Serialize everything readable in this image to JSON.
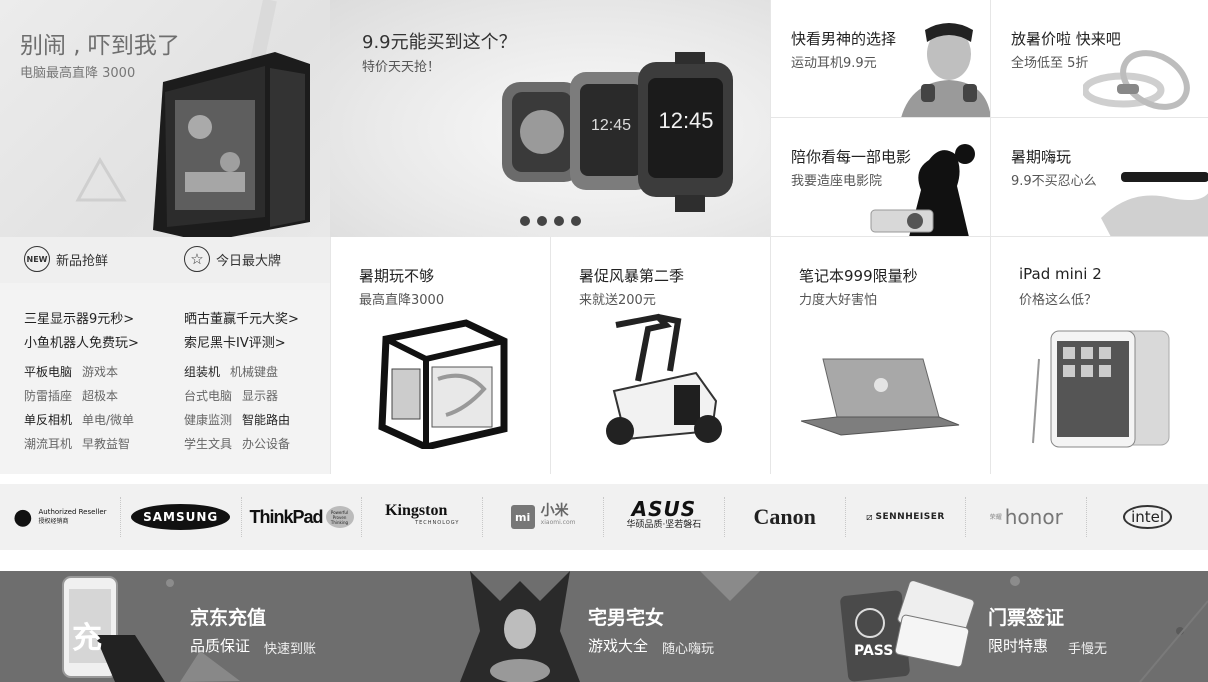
{
  "hero_left": {
    "title": "别闹 , 吓到我了",
    "subtitle": "电脑最高直降 3000"
  },
  "hero_center": {
    "title": "9.9元能买到这个？",
    "subtitle": "特价天天抢！",
    "carousel_dots": 4
  },
  "small_cards": [
    {
      "title": "快看男神的选择",
      "subtitle": "运动耳机9.9元"
    },
    {
      "title": "放暑价啦 快来吧",
      "subtitle": "全场低至 5折"
    },
    {
      "title": "陪你看每一部电影",
      "subtitle": "我要造座电影院"
    },
    {
      "title": "暑期嗨玩",
      "subtitle": "9.9不买忍心么"
    }
  ],
  "left_tabs": [
    {
      "badge": "NEW",
      "label": "新品抢鲜"
    },
    {
      "badge": "☆",
      "label": "今日最大牌"
    }
  ],
  "promo_links": [
    "三星显示器9元秒>",
    "晒古董赢千元大奖>",
    "小鱼机器人免费玩>",
    "索尼黑卡IV评测>"
  ],
  "category_links": [
    [
      "平板电脑",
      "游戏本",
      "组装机",
      "机械键盘"
    ],
    [
      "防雷插座",
      "超极本",
      "台式电脑",
      "显示器"
    ],
    [
      "单反相机",
      "单电/微单",
      "健康监测",
      "智能路由"
    ],
    [
      "潮流耳机",
      "早教益智",
      "学生文具",
      "办公设备"
    ]
  ],
  "products": [
    {
      "title": "暑期玩不够",
      "subtitle": "最高直降3000"
    },
    {
      "title": "暑促风暴第二季",
      "subtitle": "来就送200元"
    },
    {
      "title": "笔记本999限量秒",
      "subtitle": "力度大好害怕"
    },
    {
      "title": "iPad mini 2",
      "subtitle": "价格这么低？"
    }
  ],
  "brands": {
    "apple": [
      "Authorized Reseller",
      "授权经销商"
    ],
    "samsung": "SAMSUNG",
    "thinkpad": "ThinkPad",
    "thinkpad_tag": [
      "Powerful",
      "Proven",
      "Thinking"
    ],
    "kingston": "Kingston",
    "kingston_tag": "TECHNOLOGY",
    "mi_logo": "mi",
    "mi": "小米",
    "mi_url": "xiaomi.com",
    "asus": "ASUS",
    "asus_sub": "华硕品质·坚若磐石",
    "canon": "Canon",
    "sennheiser": "SENNHEISER",
    "honor_prefix": [
      "荣耀",
      ""
    ],
    "honor": "honor",
    "intel": "intel"
  },
  "bottom_banner": [
    {
      "icon_text": "充",
      "title": "京东充值",
      "sub1": "品质保证",
      "sub2": "快速到账"
    },
    {
      "title": "宅男宅女",
      "sub1": "游戏大全",
      "sub2": "随心嗨玩"
    },
    {
      "icon_text": "PASS",
      "title": "门票签证",
      "sub1": "限时特惠",
      "sub2": "手慢无"
    }
  ],
  "colors": {
    "banner_bg": "#6e6e6e",
    "brand_strip_bg": "#f1f1f1"
  }
}
